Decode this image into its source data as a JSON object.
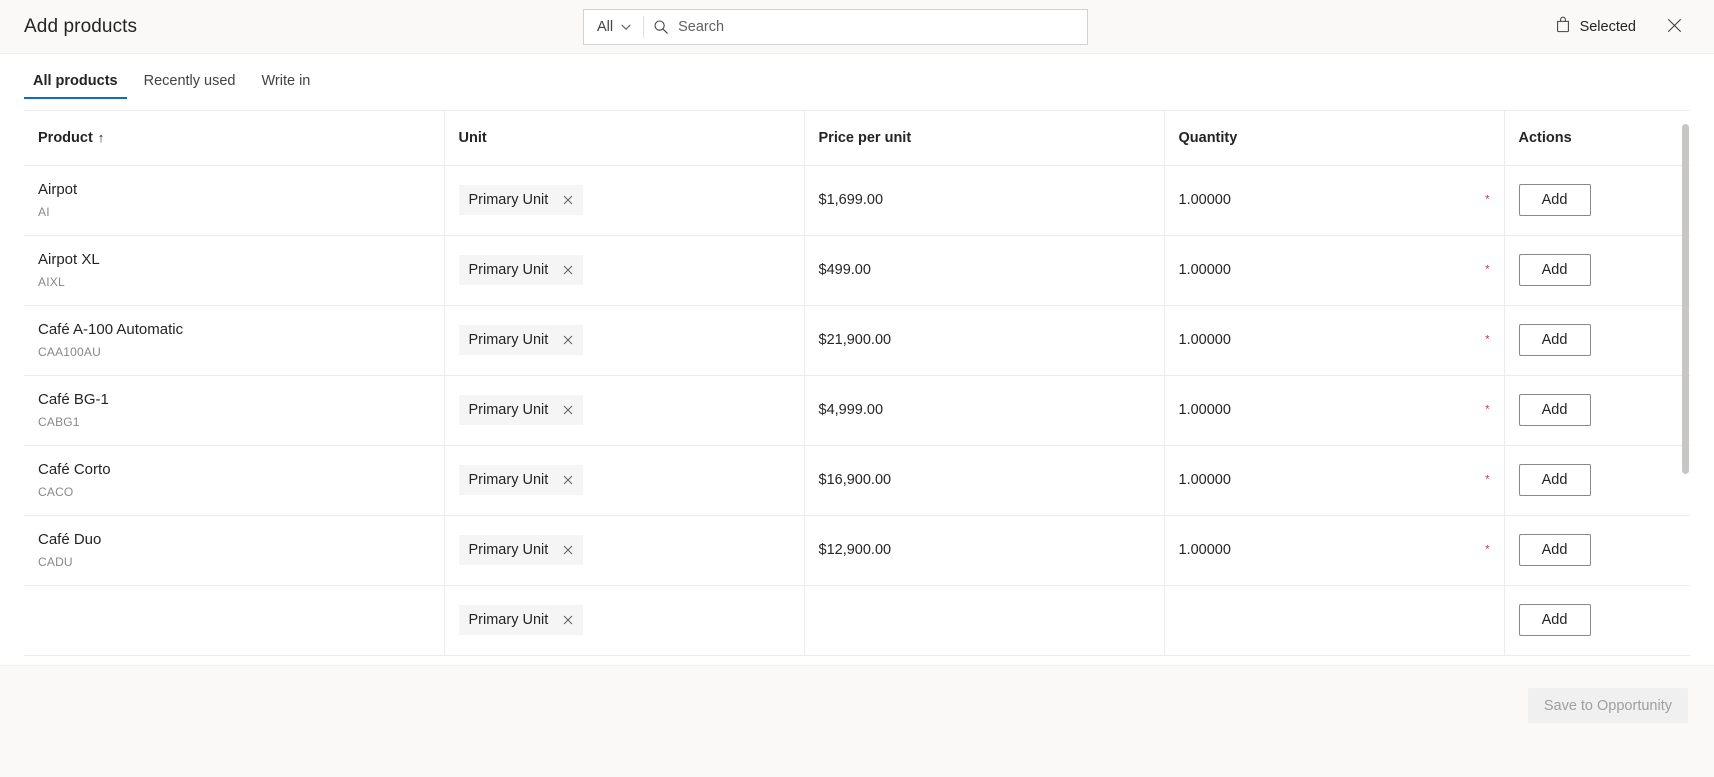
{
  "header": {
    "title": "Add products",
    "search": {
      "scope_label": "All",
      "scope_caret_icon": "chevron-down-icon",
      "search_icon": "search-icon",
      "placeholder": "Search",
      "value": ""
    },
    "selected_label": "Selected",
    "selected_icon": "shopping-bag-icon",
    "close_icon": "close-icon"
  },
  "tabs": [
    {
      "label": "All products",
      "active": true
    },
    {
      "label": "Recently used",
      "active": false
    },
    {
      "label": "Write in",
      "active": false
    }
  ],
  "grid": {
    "columns": [
      {
        "key": "product",
        "label": "Product",
        "sort": "↑"
      },
      {
        "key": "unit",
        "label": "Unit",
        "sort": ""
      },
      {
        "key": "price",
        "label": "Price per unit",
        "sort": ""
      },
      {
        "key": "quantity",
        "label": "Quantity",
        "sort": ""
      },
      {
        "key": "actions",
        "label": "Actions",
        "sort": ""
      }
    ],
    "rows": [
      {
        "name": "Airpot",
        "code": "AI",
        "unit": "Primary Unit",
        "price": "$1,699.00",
        "quantity": "1.00000",
        "required": "*",
        "action": "Add"
      },
      {
        "name": "Airpot XL",
        "code": "AIXL",
        "unit": "Primary Unit",
        "price": "$499.00",
        "quantity": "1.00000",
        "required": "*",
        "action": "Add"
      },
      {
        "name": "Café A-100 Automatic",
        "code": "CAA100AU",
        "unit": "Primary Unit",
        "price": "$21,900.00",
        "quantity": "1.00000",
        "required": "*",
        "action": "Add"
      },
      {
        "name": "Café BG-1",
        "code": "CABG1",
        "unit": "Primary Unit",
        "price": "$4,999.00",
        "quantity": "1.00000",
        "required": "*",
        "action": "Add"
      },
      {
        "name": "Café Corto",
        "code": "CACO",
        "unit": "Primary Unit",
        "price": "$16,900.00",
        "quantity": "1.00000",
        "required": "*",
        "action": "Add"
      },
      {
        "name": "Café Duo",
        "code": "CADU",
        "unit": "Primary Unit",
        "price": "$12,900.00",
        "quantity": "1.00000",
        "required": "*",
        "action": "Add"
      },
      {
        "name": "",
        "code": "",
        "unit": "Primary Unit",
        "price": "",
        "quantity": "",
        "required": "",
        "action": "Add"
      }
    ],
    "chip_remove_icon": "close-icon"
  },
  "footer": {
    "save_label": "Save to Opportunity",
    "save_disabled": true
  },
  "colors": {
    "accent": "#0f6cbd",
    "required": "#c4314b",
    "header_bg": "#faf9f8",
    "chip_bg": "#f5f5f5",
    "border": "#ececec"
  }
}
